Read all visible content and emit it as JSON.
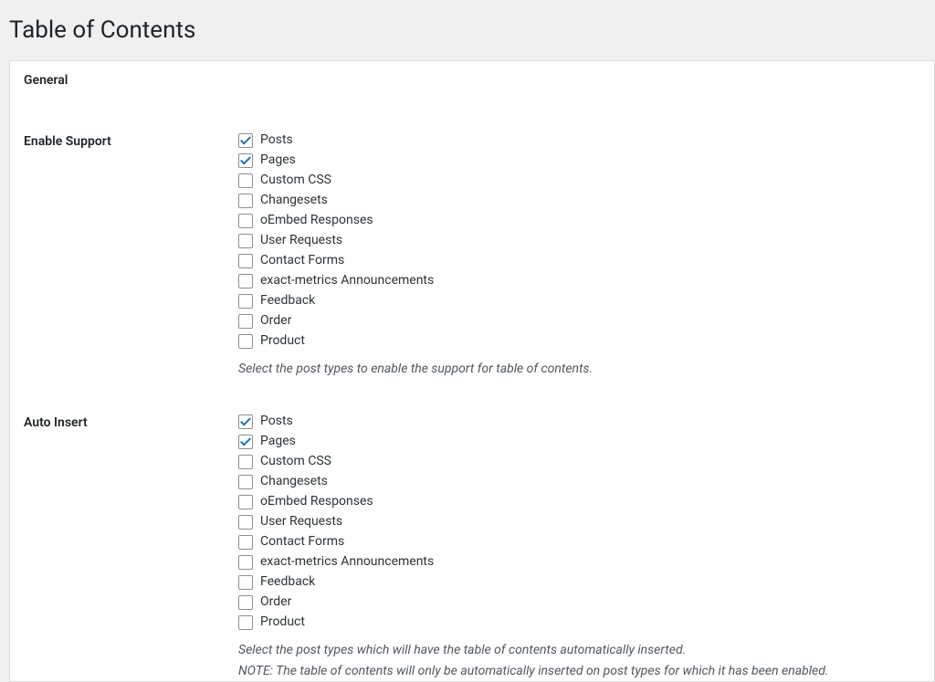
{
  "header": {
    "title": "Table of Contents"
  },
  "section": {
    "general": "General"
  },
  "enable_support": {
    "label": "Enable Support",
    "options": [
      {
        "label": "Posts",
        "checked": true
      },
      {
        "label": "Pages",
        "checked": true
      },
      {
        "label": "Custom CSS",
        "checked": false
      },
      {
        "label": "Changesets",
        "checked": false
      },
      {
        "label": "oEmbed Responses",
        "checked": false
      },
      {
        "label": "User Requests",
        "checked": false
      },
      {
        "label": "Contact Forms",
        "checked": false
      },
      {
        "label": "exact-metrics Announcements",
        "checked": false
      },
      {
        "label": "Feedback",
        "checked": false
      },
      {
        "label": "Order",
        "checked": false
      },
      {
        "label": "Product",
        "checked": false
      }
    ],
    "description": "Select the post types to enable the support for table of contents."
  },
  "auto_insert": {
    "label": "Auto Insert",
    "options": [
      {
        "label": "Posts",
        "checked": true
      },
      {
        "label": "Pages",
        "checked": true
      },
      {
        "label": "Custom CSS",
        "checked": false
      },
      {
        "label": "Changesets",
        "checked": false
      },
      {
        "label": "oEmbed Responses",
        "checked": false
      },
      {
        "label": "User Requests",
        "checked": false
      },
      {
        "label": "Contact Forms",
        "checked": false
      },
      {
        "label": "exact-metrics Announcements",
        "checked": false
      },
      {
        "label": "Feedback",
        "checked": false
      },
      {
        "label": "Order",
        "checked": false
      },
      {
        "label": "Product",
        "checked": false
      }
    ],
    "description": "Select the post types which will have the table of contents automatically inserted.",
    "note": "NOTE: The table of contents will only be automatically inserted on post types for which it has been enabled."
  }
}
